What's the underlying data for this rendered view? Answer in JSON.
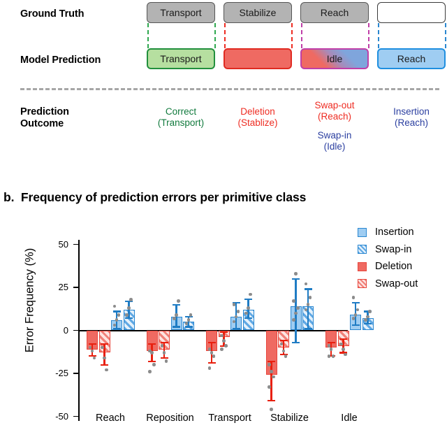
{
  "panel_a": {
    "rows": [
      {
        "key": "ground_truth",
        "label": "Ground Truth"
      },
      {
        "key": "model_prediction",
        "label": "Model Prediction"
      },
      {
        "key": "prediction_outcome",
        "label": "Prediction\nOutcome"
      }
    ],
    "row_labels": {
      "ground_truth": "Ground Truth",
      "model_prediction": "Model Prediction",
      "prediction_outcome_line1": "Prediction",
      "prediction_outcome_line2": "Outcome"
    },
    "columns": [
      {
        "ground_truth": "Transport",
        "model_prediction": "Transport",
        "outcome_line1": "Correct",
        "outcome_line2": "(Transport)",
        "outcome_color": "#117a3d",
        "connector_color": "#2fa84f",
        "prediction_style": "correct-green"
      },
      {
        "ground_truth": "Stabilize",
        "model_prediction": "",
        "outcome_line1": "Deletion",
        "outcome_line2": "(Stablize)",
        "outcome_color": "#ee2c22",
        "connector_color": "#ee2c22",
        "prediction_style": "deletion-red"
      },
      {
        "ground_truth": "Reach",
        "model_prediction": "Idle",
        "outcome_line1": "Swap-out",
        "outcome_line2": "(Reach)",
        "outcome_line3": "Swap-in",
        "outcome_line4": "(Idle)",
        "outcome_color": "#ee2c22",
        "outcome_color2": "#2b3fa0",
        "connector_color": "#c03fa8",
        "prediction_style": "swap-gradient"
      },
      {
        "ground_truth": "",
        "model_prediction": "Reach",
        "outcome_line1": "Insertion",
        "outcome_line2": "(Reach)",
        "outcome_color": "#2b3fa0",
        "connector_color": "#2a87d0",
        "prediction_style": "insertion-blue"
      }
    ]
  },
  "panel_b": {
    "label": "b.",
    "title": "Frequency of prediction errors per primitive class"
  },
  "chart_data": {
    "type": "bar",
    "title": "Frequency of prediction errors per primitive class",
    "xlabel": "",
    "ylabel": "Error Frequency (%)",
    "ylim": [
      -58,
      58
    ],
    "yticks": [
      50,
      25,
      0,
      -25,
      -50
    ],
    "ytick_labels": [
      "50",
      "25",
      "0",
      "-25",
      "-50"
    ],
    "grid": false,
    "legend_position": "top-right",
    "categories": [
      "Reach",
      "Reposition",
      "Transport",
      "Stabilize",
      "Idle"
    ],
    "series": [
      {
        "name": "Deletion",
        "fill": "#ef6a62",
        "hatch": false,
        "values": [
          -11,
          -12,
          -12,
          -26,
          -10
        ],
        "err_low": [
          -15,
          -18,
          -19,
          -41,
          -15
        ],
        "err_high": [
          -8,
          -8,
          -7,
          -18,
          -7
        ],
        "points": [
          [
            -10,
            -12,
            -16
          ],
          [
            -12,
            -13,
            -20,
            -24
          ],
          [
            -11,
            -13,
            -15,
            -22
          ],
          [
            -20,
            -24,
            -27,
            -33,
            -46
          ],
          [
            -9,
            -11,
            -15,
            -15
          ]
        ]
      },
      {
        "name": "Swap-out",
        "fill": "#fde3e1",
        "hatch": true,
        "values": [
          -13,
          -11,
          -4,
          -10,
          -9
        ],
        "err_low": [
          -20,
          -16,
          -9,
          -14,
          -13
        ],
        "err_high": [
          -8,
          -7,
          -1,
          -6,
          -5
        ],
        "points": [
          [
            -10,
            -16,
            -23
          ],
          [
            -9,
            -13,
            -18
          ],
          [
            -3,
            -6,
            -9,
            -11
          ],
          [
            -8,
            -12,
            -15
          ],
          [
            -8,
            -11,
            -14
          ]
        ]
      },
      {
        "name": "Insertion",
        "fill": "#9fcdf2",
        "hatch": false,
        "values": [
          6,
          8,
          8,
          14,
          9
        ],
        "err_low": [
          1,
          2,
          1,
          -7,
          3
        ],
        "err_high": [
          11,
          15,
          16,
          30,
          16
        ],
        "points": [
          [
            3,
            6,
            9,
            14
          ],
          [
            7,
            9,
            17
          ],
          [
            5,
            8,
            11,
            15
          ],
          [
            6,
            10,
            13,
            17,
            33
          ],
          [
            7,
            9,
            12,
            19
          ]
        ]
      },
      {
        "name": "Swap-in",
        "fill": "#e3f0fb",
        "hatch": true,
        "values": [
          12,
          5,
          12,
          14,
          7
        ],
        "err_low": [
          7,
          2,
          7,
          1,
          4
        ],
        "err_high": [
          17,
          8,
          18,
          24,
          11
        ],
        "points": [
          [
            9,
            13,
            18
          ],
          [
            4,
            6,
            9
          ],
          [
            10,
            13,
            21
          ],
          [
            12,
            15,
            19,
            27
          ],
          [
            6,
            8,
            11
          ]
        ]
      }
    ]
  },
  "legend": {
    "items": [
      {
        "label": "Insertion",
        "swatch": "lg-ins"
      },
      {
        "label": "Swap-in",
        "swatch": "lg-swi"
      },
      {
        "label": "Deletion",
        "swatch": "lg-del"
      },
      {
        "label": "Swap-out",
        "swatch": "lg-swo"
      }
    ]
  }
}
